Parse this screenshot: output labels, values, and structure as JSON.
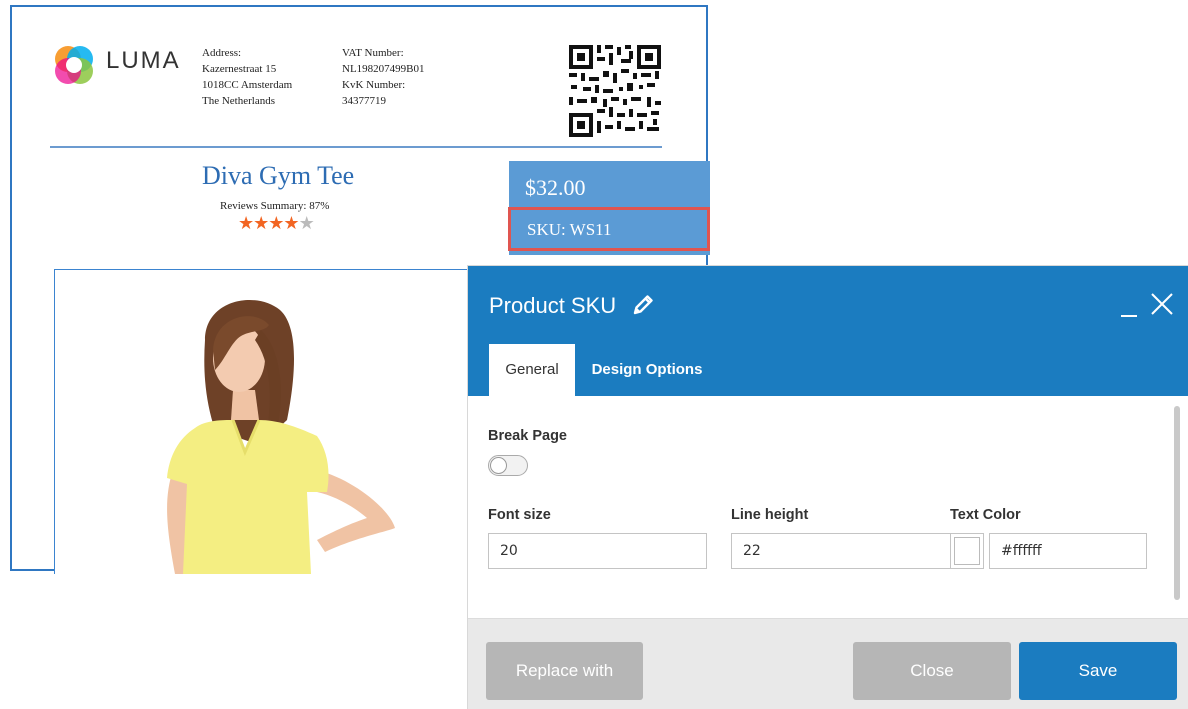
{
  "document": {
    "logo_text": "LUMA",
    "address_label": "Address:",
    "address_lines": [
      "Kazernestraat 15",
      "1018CC Amsterdam",
      "The Netherlands"
    ],
    "vat_label": "VAT Number:",
    "vat_value": "NL198207499B01",
    "kvk_label": "KvK Number:",
    "kvk_value": "34377719",
    "product_name": "Diva Gym Tee",
    "reviews_summary": "Reviews Summary: 87%",
    "rating_stars": 4,
    "rating_max": 5,
    "price": "$32.00",
    "sku": "SKU: WS11"
  },
  "modal": {
    "title": "Product SKU",
    "tabs": [
      {
        "label": "General",
        "active": true
      },
      {
        "label": "Design Options",
        "active": false
      }
    ],
    "break_page_label": "Break Page",
    "break_page_enabled": false,
    "font_size_label": "Font size",
    "font_size_value": "20",
    "line_height_label": "Line height",
    "line_height_value": "22",
    "text_color_label": "Text Color",
    "text_color_value": "#ffffff",
    "buttons": {
      "replace": "Replace with",
      "close": "Close",
      "save": "Save"
    }
  },
  "colors": {
    "accent": "#1b7cc0",
    "price_box": "#5b9bd5",
    "highlight_border": "#e05550",
    "star": "#f26522",
    "disabled_button": "#b6b6b6"
  }
}
